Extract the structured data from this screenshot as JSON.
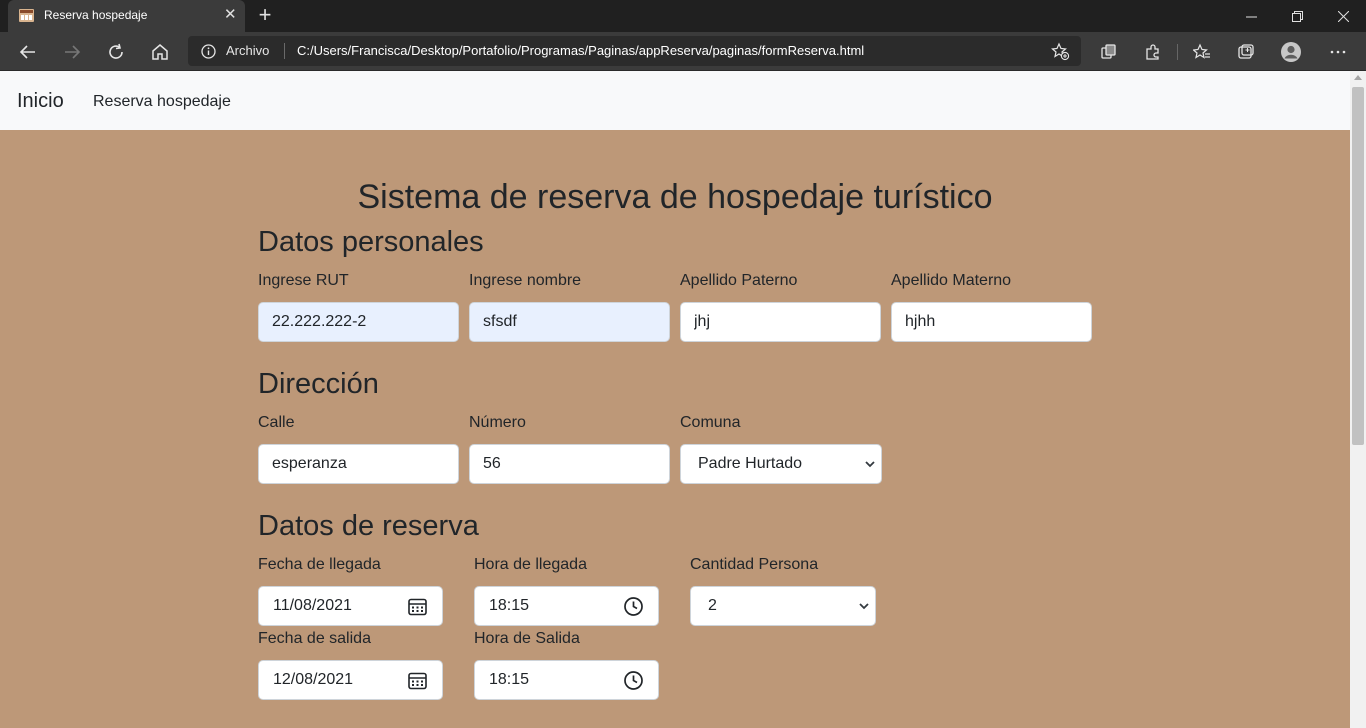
{
  "browser": {
    "tab_title": "Reserva hospedaje",
    "tab_close": "✕",
    "new_tab": "+",
    "address_scheme": "Archivo",
    "address_url": "C:/Users/Francisca/Desktop/Portafolio/Programas/Paginas/appReserva/paginas/formReserva.html",
    "controls": {
      "minimize": "—",
      "maximize": "❐",
      "close": "✕"
    }
  },
  "navbar": {
    "brand": "Inicio",
    "link": "Reserva hospedaje"
  },
  "page": {
    "title": "Sistema de reserva de hospedaje turístico"
  },
  "personal": {
    "heading": "Datos personales",
    "rut_label": "Ingrese RUT",
    "rut_value": "22.222.222-2",
    "name_label": "Ingrese nombre",
    "name_value": "sfsdf",
    "paternal_label": "Apellido Paterno",
    "paternal_value": "jhj",
    "maternal_label": "Apellido Materno",
    "maternal_value": "hjhh"
  },
  "address": {
    "heading": "Dirección",
    "street_label": "Calle",
    "street_value": "esperanza",
    "number_label": "Número",
    "number_value": "56",
    "comuna_label": "Comuna",
    "comuna_value": "Padre Hurtado"
  },
  "reservation": {
    "heading": "Datos de reserva",
    "arrival_date_label": "Fecha de llegada",
    "arrival_date_value": "11/08/2021",
    "arrival_time_label": "Hora de llegada",
    "arrival_time_value": "18:15",
    "people_label": "Cantidad Persona",
    "people_value": "2",
    "departure_date_label": "Fecha de salida",
    "departure_date_value": "12/08/2021",
    "departure_time_label": "Hora de Salida",
    "departure_time_value": "18:15"
  },
  "colors": {
    "page_background": "#bd9878",
    "navbar_background": "#f8f9fa",
    "autofill_background": "#e8f0fe",
    "chrome_dark": "#202020",
    "chrome_toolbar": "#3b3b3b"
  },
  "icons": [
    "tab-favicon-icon",
    "close-icon",
    "plus-icon",
    "back-icon",
    "forward-icon",
    "refresh-icon",
    "home-icon",
    "info-icon",
    "favorite-add-icon",
    "collections-icon",
    "extensions-icon",
    "favorites-icon",
    "tab-actions-icon",
    "profile-icon",
    "more-icon",
    "calendar-icon",
    "clock-icon",
    "chevron-down-icon"
  ]
}
